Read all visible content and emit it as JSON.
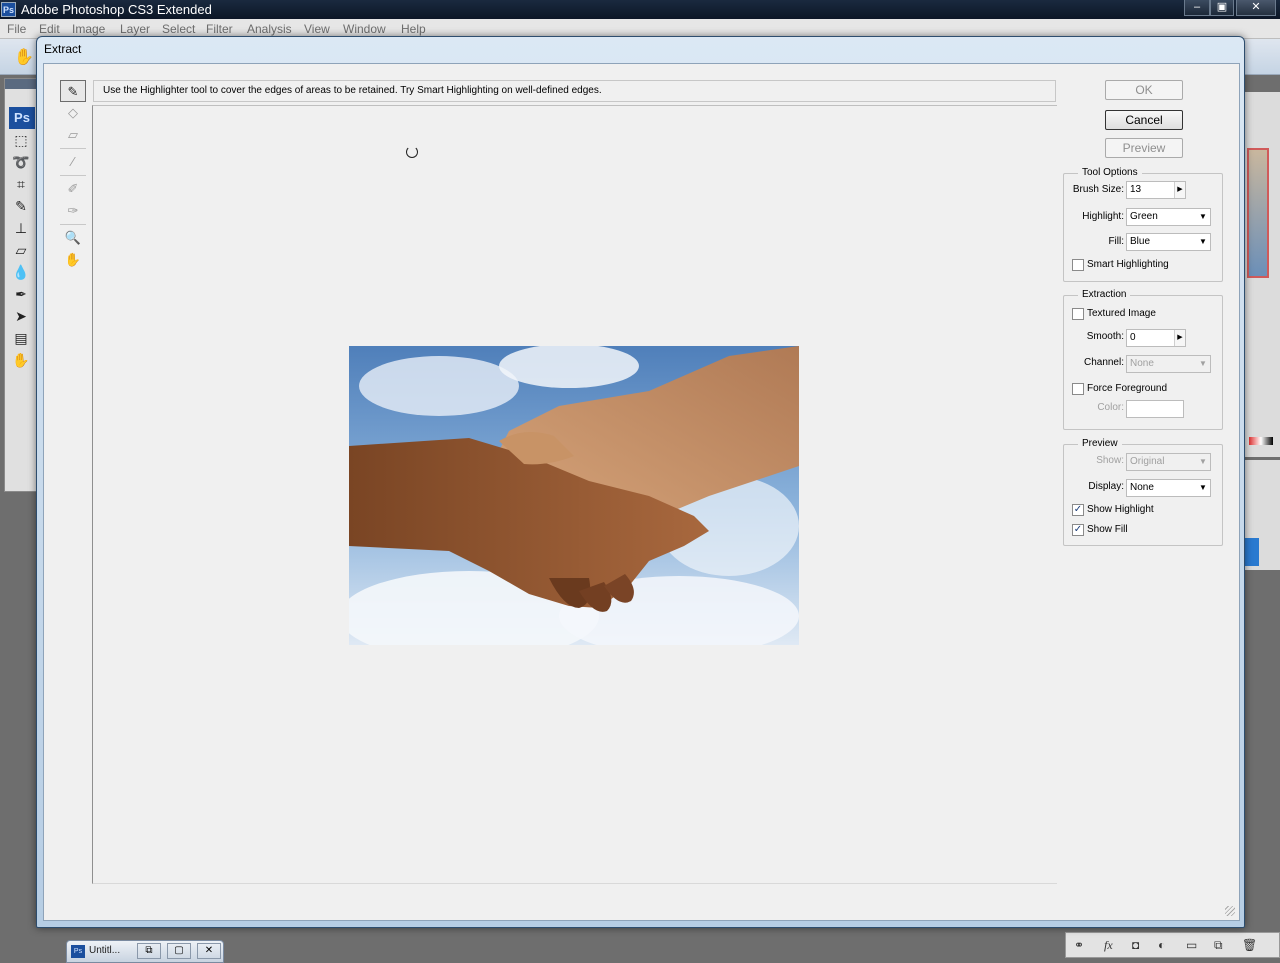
{
  "app": {
    "title": "Adobe Photoshop CS3 Extended",
    "badge": "Ps",
    "window_buttons": [
      "–",
      "▣",
      "✕"
    ]
  },
  "menu": [
    "File",
    "Edit",
    "Image",
    "Layer",
    "Select",
    "Filter",
    "Analysis",
    "View",
    "Window",
    "Help"
  ],
  "toolbox": {
    "logo": "Ps",
    "tools": [
      "marquee-icon",
      "lasso-icon",
      "crop-icon",
      "healing-icon",
      "stamp-icon",
      "eraser-icon",
      "blur-icon",
      "pen-icon",
      "path-select-icon",
      "notes-icon",
      "hand-icon"
    ]
  },
  "dialog": {
    "title": "Extract",
    "instruction": "Use the Highlighter tool to cover the edges of areas to be retained. Try Smart Highlighting on well-defined edges.",
    "tools": [
      "edge-highlighter-icon",
      "fill-icon",
      "eraser-icon",
      "eyedropper-icon",
      "cleanup-icon",
      "edge-touchup-icon",
      "zoom-icon",
      "hand-icon"
    ],
    "buttons": {
      "ok": "OK",
      "cancel": "Cancel",
      "preview": "Preview"
    },
    "tool_options": {
      "title": "Tool Options",
      "brush_size_label": "Brush Size:",
      "brush_size": "13",
      "highlight_label": "Highlight:",
      "highlight": "Green",
      "fill_label": "Fill:",
      "fill": "Blue",
      "smart_highlighting": "Smart Highlighting",
      "smart_highlighting_checked": false
    },
    "extraction": {
      "title": "Extraction",
      "textured_image": "Textured Image",
      "textured_image_checked": false,
      "smooth_label": "Smooth:",
      "smooth": "0",
      "channel_label": "Channel:",
      "channel": "None",
      "force_foreground": "Force Foreground",
      "force_foreground_checked": false,
      "color_label": "Color:",
      "color": ""
    },
    "preview": {
      "title": "Preview",
      "show_label": "Show:",
      "show": "Original",
      "display_label": "Display:",
      "display": "None",
      "show_highlight": "Show Highlight",
      "show_highlight_checked": true,
      "show_fill": "Show Fill",
      "show_fill_checked": true
    }
  },
  "taskbar": {
    "doc_label": "Untitl..."
  },
  "colors": {
    "sky_top": "#5f8fc4",
    "sky_light": "#e8eff7",
    "skin_dark": "#7a4a2a",
    "skin_light": "#c8956a"
  }
}
